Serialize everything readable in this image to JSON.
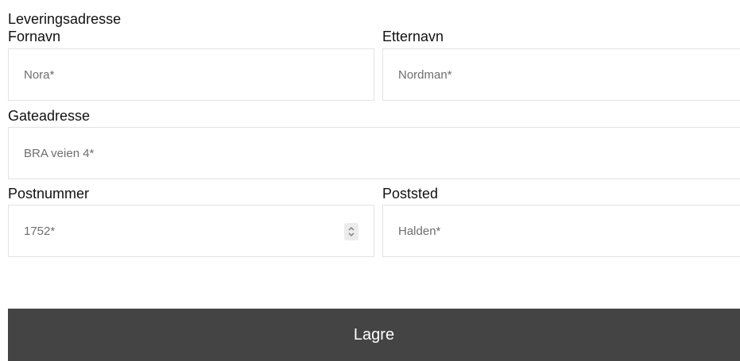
{
  "form": {
    "title": "Leveringsadresse",
    "first_name": {
      "label": "Fornavn",
      "placeholder": "Nora*",
      "value": ""
    },
    "last_name": {
      "label": "Etternavn",
      "placeholder": "Nordman*",
      "value": ""
    },
    "street": {
      "label": "Gateadresse",
      "placeholder": "BRA veien 4*",
      "value": ""
    },
    "postal_code": {
      "label": "Postnummer",
      "placeholder": "1752*",
      "value": ""
    },
    "city": {
      "label": "Poststed",
      "placeholder": "Halden*",
      "value": ""
    },
    "save_label": "Lagre"
  },
  "icons": {
    "stepper": "up-down-chevron-icon"
  },
  "colors": {
    "button_bg": "#444444",
    "button_text": "#ffffff",
    "field_border": "#e3e3e3",
    "placeholder_text": "#6e6e6e"
  }
}
